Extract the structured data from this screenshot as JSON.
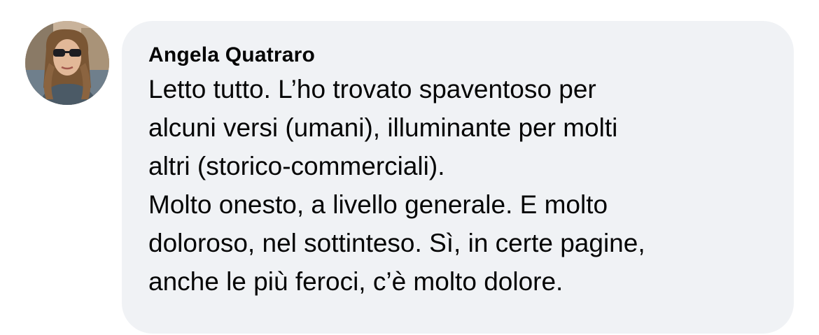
{
  "comment": {
    "author": "Angela Quatraro",
    "avatar_icon": "user-profile-photo",
    "lines": [
      "Letto tutto. L’ho trovato spaventoso per",
      "alcuni versi (umani), illuminante per molti",
      "altri (storico-commerciali).",
      "Molto onesto, a livello generale. E molto",
      "doloroso, nel sottinteso. Sì, in certe pagine,",
      "anche le più feroci, c’è molto dolore."
    ]
  },
  "colors": {
    "bubble_background": "#f0f2f5",
    "text": "#050505"
  }
}
